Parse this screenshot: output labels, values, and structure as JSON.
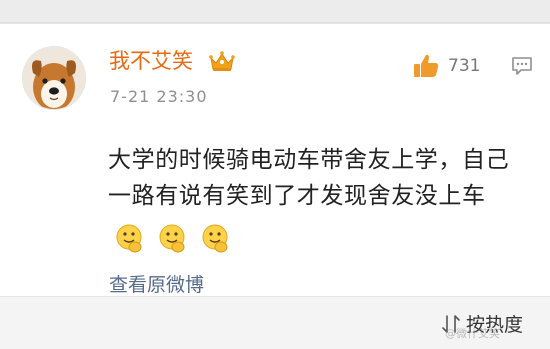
{
  "post": {
    "username": "我不艾笑",
    "timestamp": "7-21 23:30",
    "like_count": "731",
    "body_text": "大学的时候骑电动车带舍友上学，自己一路有说有笑到了才发现舍友没上车",
    "emojis": [
      "face-emoji",
      "face-emoji",
      "face-emoji"
    ],
    "view_original_label": "查看原微博"
  },
  "footer": {
    "sort_label": "按热度",
    "watermark": "@微什艾笑"
  },
  "colors": {
    "username": "#e76a13",
    "link": "#566b8c",
    "crown": "#f1a11c",
    "like_icon": "#f09a2b"
  },
  "icons": {
    "avatar": "dog-avatar",
    "badge": "crown-icon",
    "like": "thumbs-up-icon",
    "comment": "comment-icon",
    "sort": "sort-icon"
  }
}
